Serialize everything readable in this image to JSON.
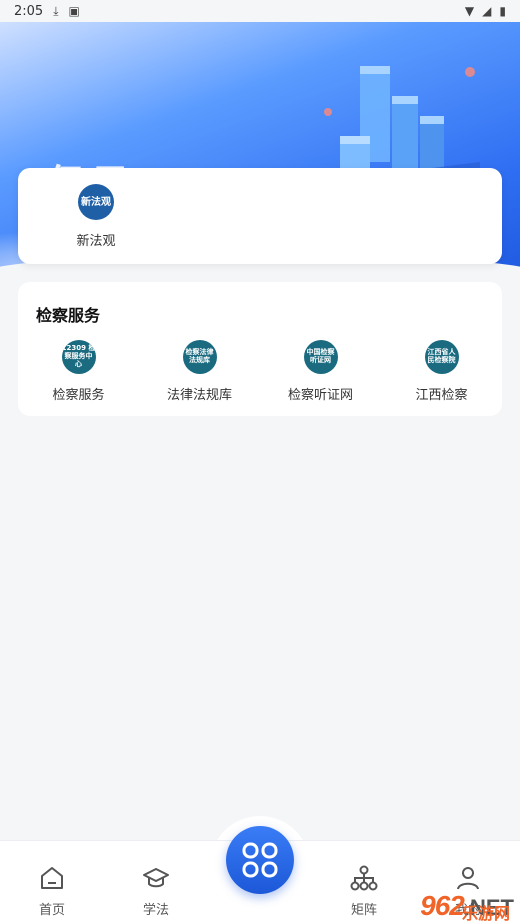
{
  "status_bar": {
    "time": "2:05",
    "icons": [
      "download-icon",
      "notification-a-icon",
      "wifi-icon",
      "signal-icon",
      "battery-icon"
    ]
  },
  "hero": {
    "text": "仍日"
  },
  "featured": {
    "items": [
      {
        "label": "新法观",
        "logo_text": "新法观"
      }
    ]
  },
  "services": {
    "title": "检察服务",
    "items": [
      {
        "label": "检察服务",
        "logo_text": "12309\n检察服务中心"
      },
      {
        "label": "法律法规库",
        "logo_text": "检察法律法规库"
      },
      {
        "label": "检察听证网",
        "logo_text": "中国检察听证网"
      },
      {
        "label": "江西检察",
        "logo_text": "江西省人民检察院"
      }
    ]
  },
  "bottom_nav": {
    "items": [
      {
        "label": "首页",
        "icon": "home-icon"
      },
      {
        "label": "学法",
        "icon": "graduation-cap-icon"
      },
      {
        "label": "矩阵",
        "icon": "org-chart-icon"
      },
      {
        "label": "我的",
        "icon": "user-icon"
      }
    ],
    "center_icon": "apps-grid-icon"
  },
  "watermark": {
    "main": "962",
    "net": ".NET",
    "sub": "乐游网"
  },
  "colors": {
    "accent": "#1c58d8",
    "hero_blue": "#2f6ef2",
    "watermark_orange": "#f0642a"
  }
}
